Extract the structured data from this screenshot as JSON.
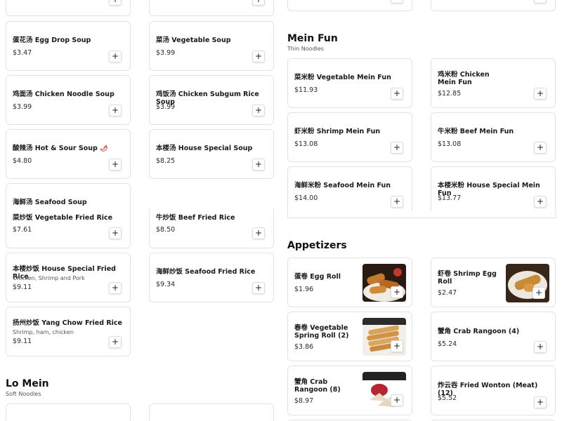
{
  "add_label": "+",
  "chili_glyph": "🌶",
  "left_column": {
    "soups": [
      {
        "name": "蛋花汤 Egg Drop Soup",
        "price": "$3.47"
      },
      {
        "name": "菜汤 Vegetable Soup",
        "price": "$3.99"
      },
      {
        "name": "鸡面汤 Chicken Noodle Soup",
        "price": "$3.99"
      },
      {
        "name": "鸡饭汤 Chicken Subgum Rice Soup",
        "price": "$3.99"
      },
      {
        "name": "酸辣汤 Hot & Sour Soup",
        "price": "$4.80"
      },
      {
        "name": "本楼汤 House Special Soup",
        "price": "$8.25"
      },
      {
        "name": "海鲜汤 Seafood Soup",
        "price": ""
      }
    ],
    "fried_rice": [
      {
        "name": "菜炒饭 Vegetable Fried Rice",
        "price": "$7.61"
      },
      {
        "name": "牛炒饭 Beef Fried Rice",
        "price": "$8.50"
      },
      {
        "name": "本楼炒饭 House Special Fried Rice",
        "desc": "Chicken, Shrimp and Pork",
        "price": "$9.11"
      },
      {
        "name": "海鲜炒饭 Seafood Fried Rice",
        "price": "$9.34"
      },
      {
        "name": "扬州炒饭 Yang Chow Fried Rice",
        "desc": "Shrimp, ham, chicken",
        "price": "$9.11"
      }
    ],
    "lo_mein": {
      "title": "Lo Mein",
      "subtitle": "Soft Noodles"
    }
  },
  "mein_fun": {
    "title": "Mein Fun",
    "subtitle": "Thin Noodles",
    "items": [
      {
        "name": "菜米粉 Vegetable Mein Fun",
        "price": "$11.93"
      },
      {
        "name": "鸡米粉 Chicken Mein Fun",
        "price": "$12.85"
      },
      {
        "name": "虾米粉 Shrimp Mein Fun",
        "price": "$13.08"
      },
      {
        "name": "牛米粉 Beef Mein Fun",
        "price": "$13.08"
      },
      {
        "name": "海鲜米粉 Seafood Mein Fun",
        "price": "$14.00"
      },
      {
        "name": "本楼米粉 House Special Mein Fun",
        "price": "$13.77"
      }
    ]
  },
  "appetizers": {
    "title": "Appetizers",
    "items": [
      {
        "name": "蛋卷 Egg Roll",
        "price": "$1.96",
        "photo": "egg-roll"
      },
      {
        "name": "虾卷 Shrimp Egg Roll",
        "price": "$2.47",
        "photo": "shrimp-egg-roll"
      },
      {
        "name": "春卷 Vegetable Spring Roll (2)",
        "price": "$3.86",
        "photo": "spring-roll"
      },
      {
        "name": "蟹角 Crab Rangoon (4)",
        "price": "$5.24"
      },
      {
        "name": "蟹角 Crab Rangoon (8)",
        "price": "$8.97",
        "photo": "crab-rangoon"
      },
      {
        "name": "炸云吞 Fried Wonton (Meat) (12)",
        "price": "$5.52"
      }
    ]
  },
  "colors": {
    "border": "#e3e3e3",
    "text": "#1a1a1a",
    "chili": "#c0392b"
  }
}
